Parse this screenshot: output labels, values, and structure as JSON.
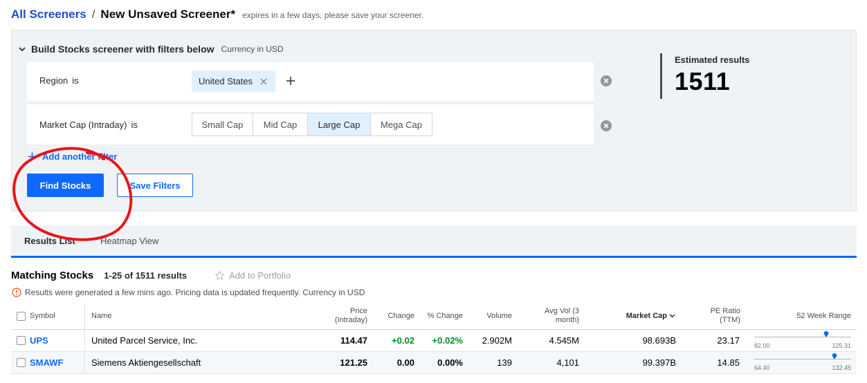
{
  "header": {
    "breadcrumb_link": "All Screeners",
    "separator": "/",
    "title": "New Unsaved Screener*",
    "note": "expires in a few days, please save your screener."
  },
  "builder": {
    "title": "Build Stocks screener with filters below",
    "currency": "Currency in USD",
    "filters": {
      "region": {
        "label": "Region",
        "op": "is",
        "chip": "United States"
      },
      "market_cap": {
        "label": "Market Cap (Intraday)",
        "op": "is",
        "options": [
          "Small Cap",
          "Mid Cap",
          "Large Cap",
          "Mega Cap"
        ],
        "selected": "Large Cap"
      }
    },
    "add_filter": "Add another filter",
    "find_button": "Find Stocks",
    "save_button": "Save Filters",
    "estimated_label": "Estimated results",
    "estimated_count": "1511"
  },
  "tabs": {
    "results": "Results List",
    "heatmap": "Heatmap View"
  },
  "matching": {
    "title": "Matching Stocks",
    "count": "1-25 of 1511 results",
    "add_portfolio": "Add to Portfolio",
    "notice": "Results were generated a few mins ago. Pricing data is updated frequently. Currency in USD"
  },
  "table": {
    "headers": {
      "symbol": "Symbol",
      "name": "Name",
      "price_1": "Price",
      "price_2": "(Intraday)",
      "change": "Change",
      "pct_change": "% Change",
      "volume": "Volume",
      "avg_vol_1": "Avg Vol (3",
      "avg_vol_2": "month)",
      "market_cap": "Market Cap",
      "pe_1": "PE Ratio",
      "pe_2": "(TTM)",
      "week_range": "52 Week Range"
    },
    "rows": [
      {
        "symbol": "UPS",
        "name": "United Parcel Service, Inc.",
        "price": "114.47",
        "change": "+0.02",
        "pct_change": "+0.02%",
        "volume": "2.902M",
        "avg_vol": "4.545M",
        "market_cap": "98.693B",
        "pe": "23.17",
        "low": "82.00",
        "high": "125.31",
        "range_pos": 0.74,
        "trend": "up"
      },
      {
        "symbol": "SMAWF",
        "name": "Siemens Aktiengesellschaft",
        "price": "121.25",
        "change": "0.00",
        "pct_change": "0.00%",
        "volume": "139",
        "avg_vol": "4,101",
        "market_cap": "99.397B",
        "pe": "14.85",
        "low": "64.40",
        "high": "132.45",
        "range_pos": 0.83,
        "trend": "flat"
      }
    ]
  },
  "colors": {
    "accent": "#0f69ff",
    "link": "#1d4fc4",
    "positive": "#008a27",
    "annotation": "#e8161b"
  }
}
